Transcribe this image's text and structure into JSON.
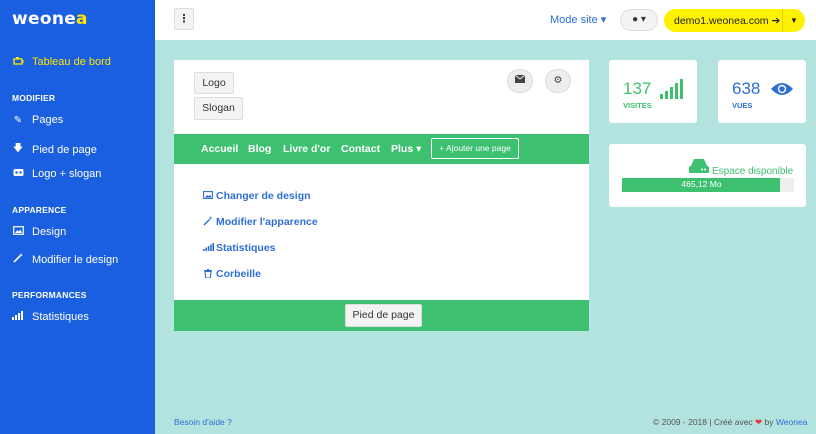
{
  "sidebar": {
    "logo_main": "weone",
    "logo_accent": "a",
    "active_item": "Tableau de bord",
    "sections": [
      {
        "heading": "MODIFIER",
        "items": [
          "Pages",
          "Pied de page",
          "Logo + slogan"
        ]
      },
      {
        "heading": "APPARENCE",
        "items": [
          "Design",
          "Modifier le design"
        ]
      },
      {
        "heading": "PERFORMANCES",
        "items": [
          "Statistiques"
        ]
      }
    ]
  },
  "topbar": {
    "kebab": "⋮",
    "mode_label": "Mode site ▾",
    "user_label": "● ▾",
    "domain": "demo1.weonea.com ➔",
    "domain_caret": "▼"
  },
  "preview": {
    "logo_btn": "Logo",
    "slogan_btn": "Slogan",
    "nav": [
      "Accueil",
      "Blog",
      "Livre d'or",
      "Contact",
      "Plus ▾"
    ],
    "add_page": "+ Ajouter une page",
    "links": [
      "Changer de design",
      "Modifier l'apparence",
      "Statistiques",
      "Corbeille"
    ],
    "footer_btn": "Pied de page"
  },
  "stats": {
    "visits_value": "137",
    "visits_label": "VISITES",
    "views_value": "638",
    "views_label": "VUES"
  },
  "disk": {
    "title": "Espace disponible",
    "value": "465,12 Mo",
    "fill_fraction": 0.92
  },
  "footer": {
    "help": "Besoin d'aide ?",
    "copyright_pre": "© 2009 - 2018 | Créé avec",
    "heart": "❤",
    "by": "by",
    "brand": "Weonea"
  },
  "colors": {
    "sidebar": "#1a5fe0",
    "accent_yellow": "#fff200",
    "green": "#3ec071",
    "link_blue": "#2f6fd4",
    "background": "#b3e3df"
  }
}
